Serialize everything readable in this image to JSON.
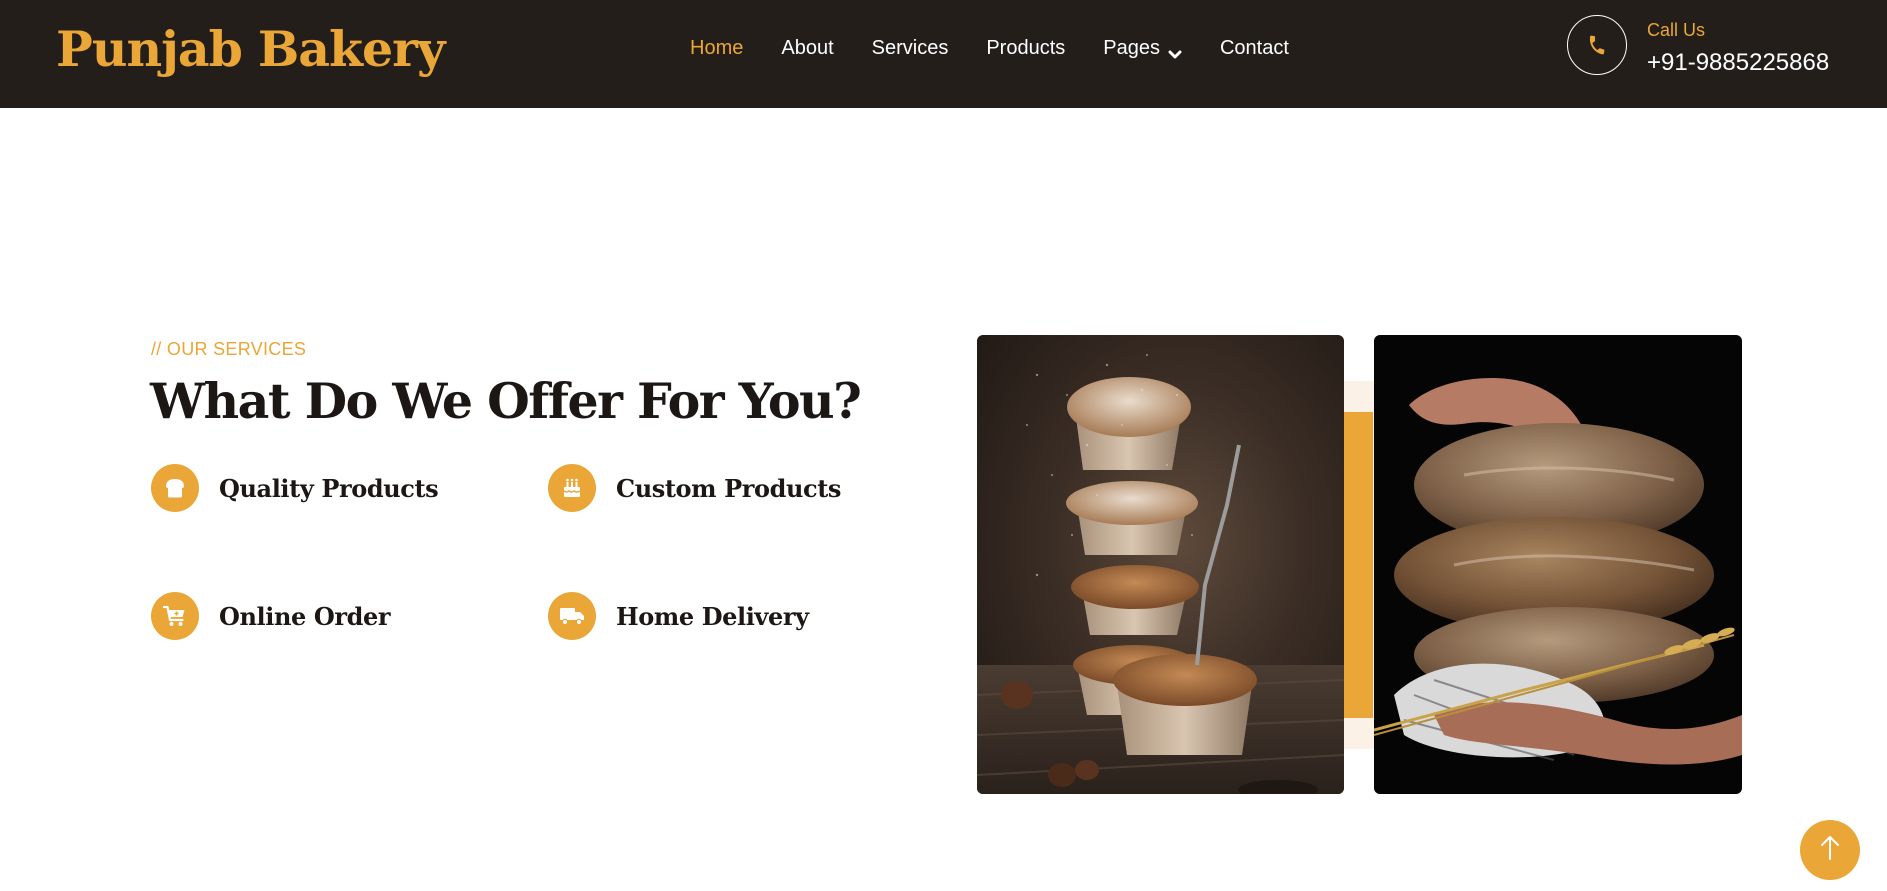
{
  "brand": {
    "name": "Punjab Bakery",
    "color": "#eaa636"
  },
  "nav": {
    "items": [
      {
        "label": "Home",
        "active": true
      },
      {
        "label": "About",
        "active": false
      },
      {
        "label": "Services",
        "active": false
      },
      {
        "label": "Products",
        "active": false
      },
      {
        "label": "Pages",
        "active": false,
        "icon": "chevron-down-icon"
      },
      {
        "label": "Contact",
        "active": false
      }
    ]
  },
  "call": {
    "label": "Call Us",
    "number": "+91-9885225868",
    "icon": "phone-icon"
  },
  "services": {
    "eyebrow": "// OUR SERVICES",
    "heading": "What Do We Offer For You?",
    "items": [
      {
        "label": "Quality Products",
        "icon": "bread-icon"
      },
      {
        "label": "Custom Products",
        "icon": "cake-icon"
      },
      {
        "label": "Online Order",
        "icon": "cart-icon"
      },
      {
        "label": "Home Delivery",
        "icon": "truck-icon"
      }
    ]
  },
  "images": [
    {
      "subject": "muffins-photo"
    },
    {
      "subject": "bread-loaves-photo"
    }
  ],
  "scroll_top": {
    "icon": "arrow-up-icon"
  },
  "colors": {
    "accent": "#eaa636",
    "navbar": "#241e1b",
    "heading": "#1c1614"
  }
}
